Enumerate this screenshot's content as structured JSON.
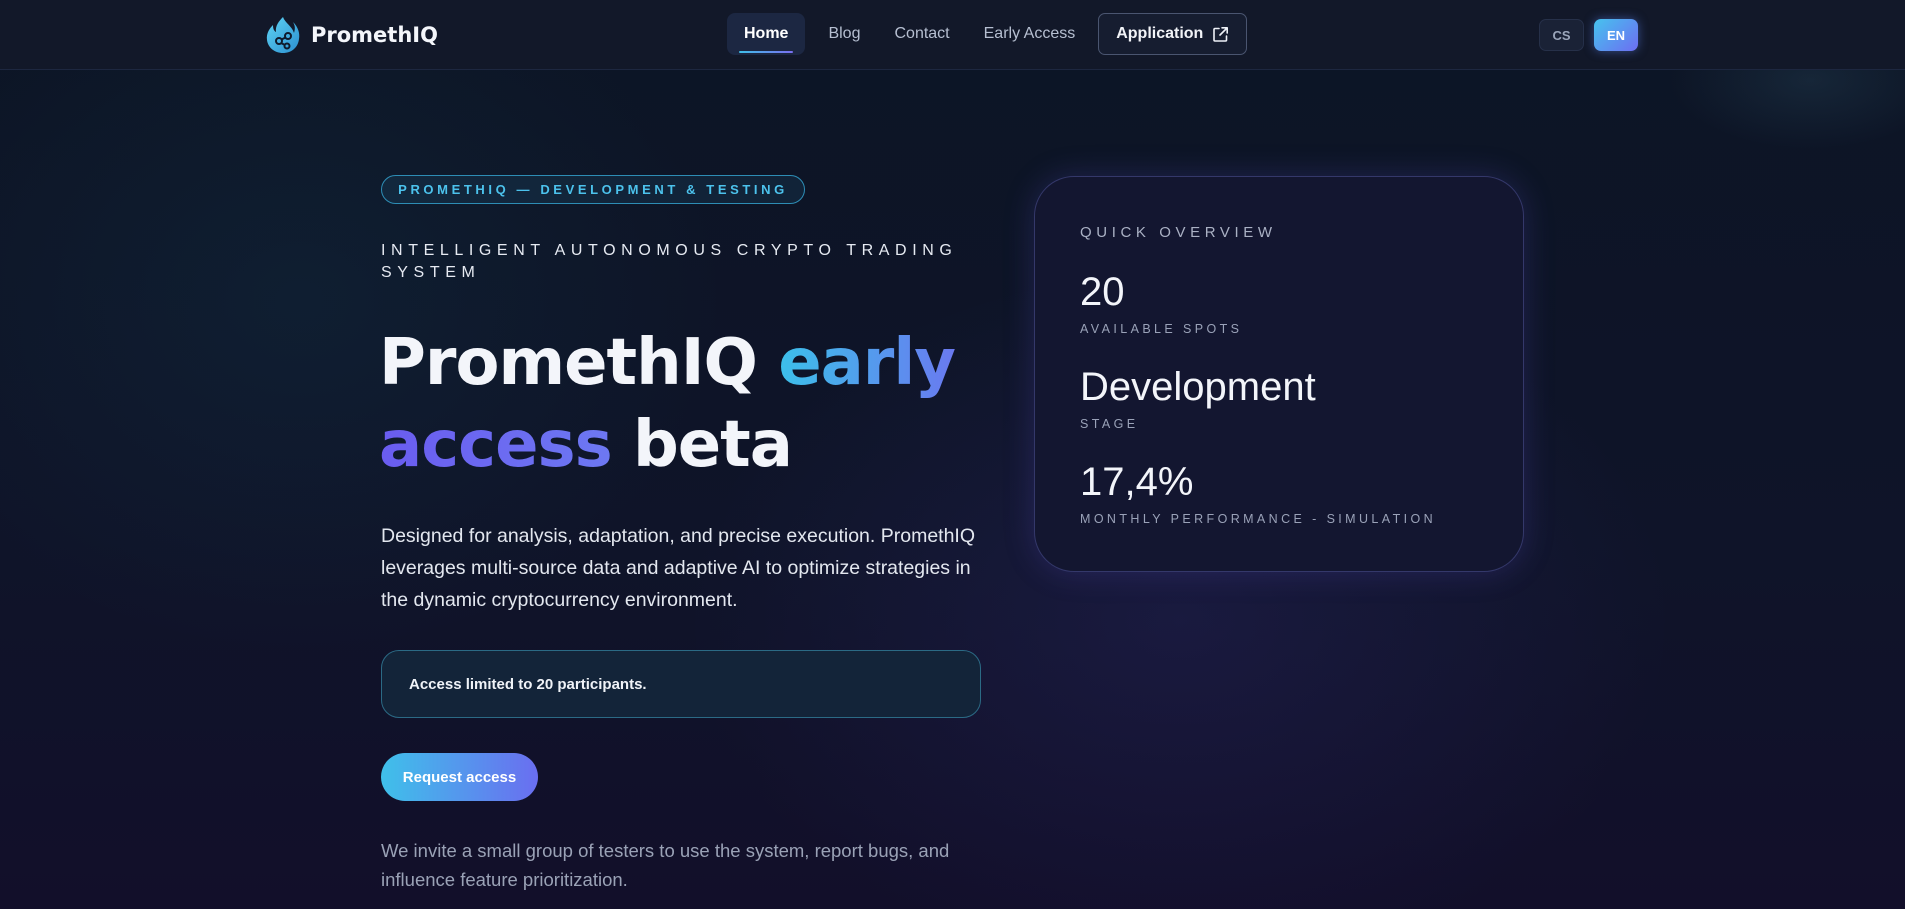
{
  "brand": {
    "name": "PromethIQ"
  },
  "nav": {
    "links": [
      "Home",
      "Blog",
      "Contact",
      "Early Access"
    ],
    "application_label": "Application",
    "languages": [
      "CS",
      "EN"
    ],
    "active_language": "EN"
  },
  "hero": {
    "badge": "PROMETHIQ — DEVELOPMENT & TESTING",
    "subtitle": "INTELLIGENT AUTONOMOUS CRYPTO TRADING SYSTEM",
    "headline": {
      "part1": "PromethIQ ",
      "part2": "early",
      "part3": "access",
      "part4": " beta"
    },
    "description": "Designed for analysis, adaptation, and precise execution. PromethIQ leverages multi-source data and adaptive AI to optimize strategies in the dynamic cryptocurrency environment.",
    "notice": "Access limited to 20 participants.",
    "cta": "Request access",
    "invite": "We invite a small group of testers to use the system, report bugs, and influence feature prioritization."
  },
  "overview": {
    "title": "QUICK OVERVIEW",
    "stats": [
      {
        "value": "20",
        "label": "AVAILABLE SPOTS"
      },
      {
        "value": "Development",
        "label": "STAGE"
      },
      {
        "value": "17,4%",
        "label": "MONTHLY PERFORMANCE - SIMULATION"
      }
    ]
  },
  "colors": {
    "accent_cyan": "#3fc0ea",
    "accent_violet": "#6a6ef0",
    "background": "#0d1424"
  }
}
